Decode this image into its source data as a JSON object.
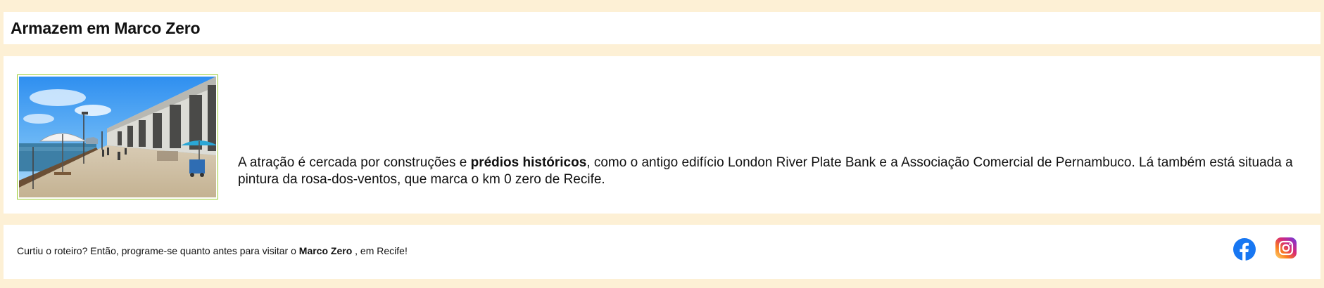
{
  "page": {
    "title": "Armazem em Marco Zero"
  },
  "content": {
    "image_alt": "Armazém e calçadão no Marco Zero, Recife",
    "paragraph_before": "A atração é cercada por construções e ",
    "paragraph_bold": "prédios históricos",
    "paragraph_after": ", como o antigo edifício London River Plate Bank e a Associação Comercial de Pernambuco. Lá também está situada a pintura da rosa-dos-ventos, que marca o km 0 zero de Recife."
  },
  "footer": {
    "text_before": "Curtiu o roteiro? Então, programe-se quanto antes para visitar o ",
    "text_bold": "Marco Zero",
    "text_after": " , em Recife!",
    "social": [
      {
        "name": "facebook",
        "icon": "facebook-icon",
        "color": "#1877f2"
      },
      {
        "name": "instagram",
        "icon": "instagram-icon",
        "color": "#e1306c"
      }
    ]
  },
  "colors": {
    "page_background": "#fdf0d5",
    "card_background": "#ffffff",
    "image_border": "#9acd32"
  }
}
